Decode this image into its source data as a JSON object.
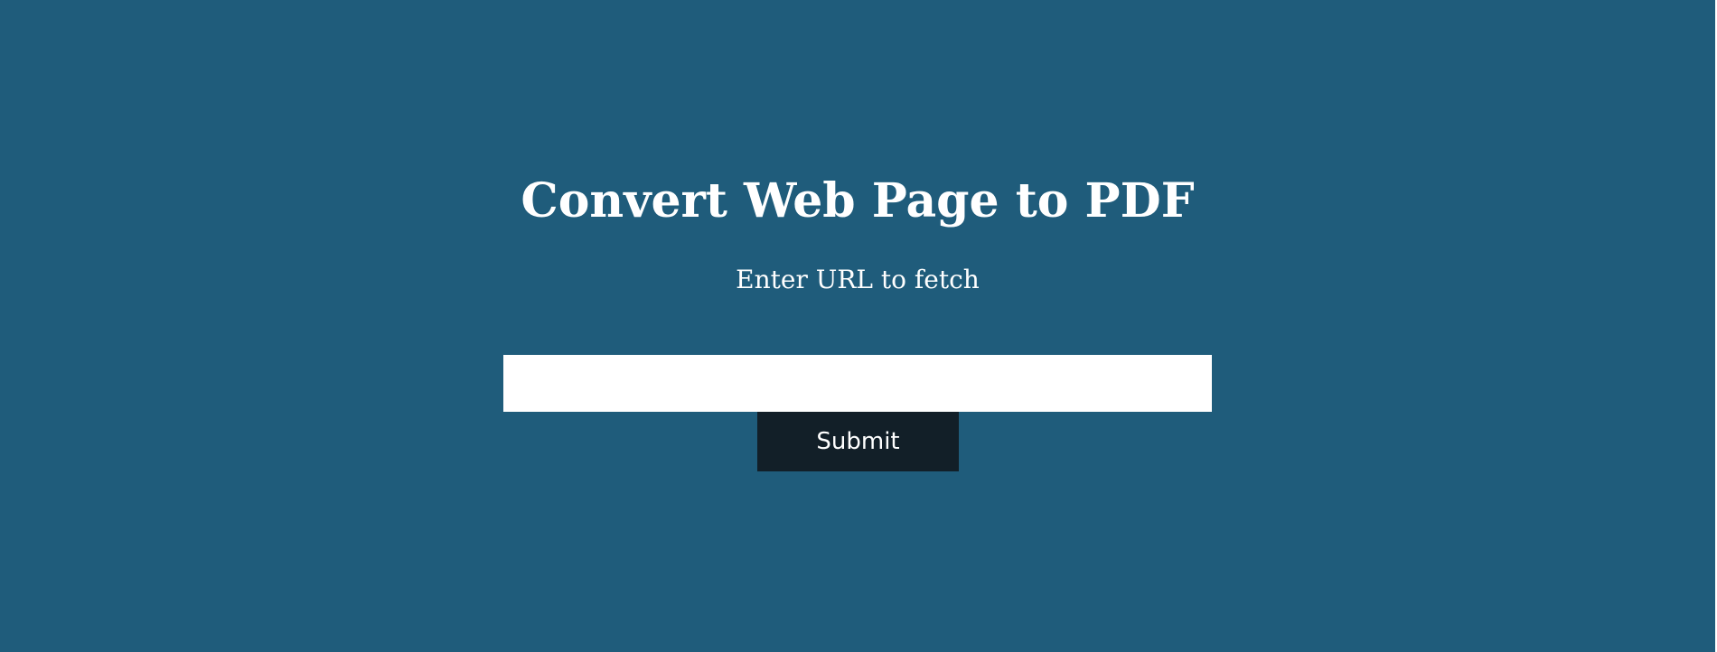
{
  "page": {
    "background_color": "#1f5c7b"
  },
  "header": {
    "title": "Convert Web Page to PDF",
    "subtitle": "Enter URL to fetch"
  },
  "form": {
    "url_input": {
      "value": "",
      "placeholder": ""
    },
    "submit_label": "Submit",
    "submit_color": "#121f28"
  }
}
